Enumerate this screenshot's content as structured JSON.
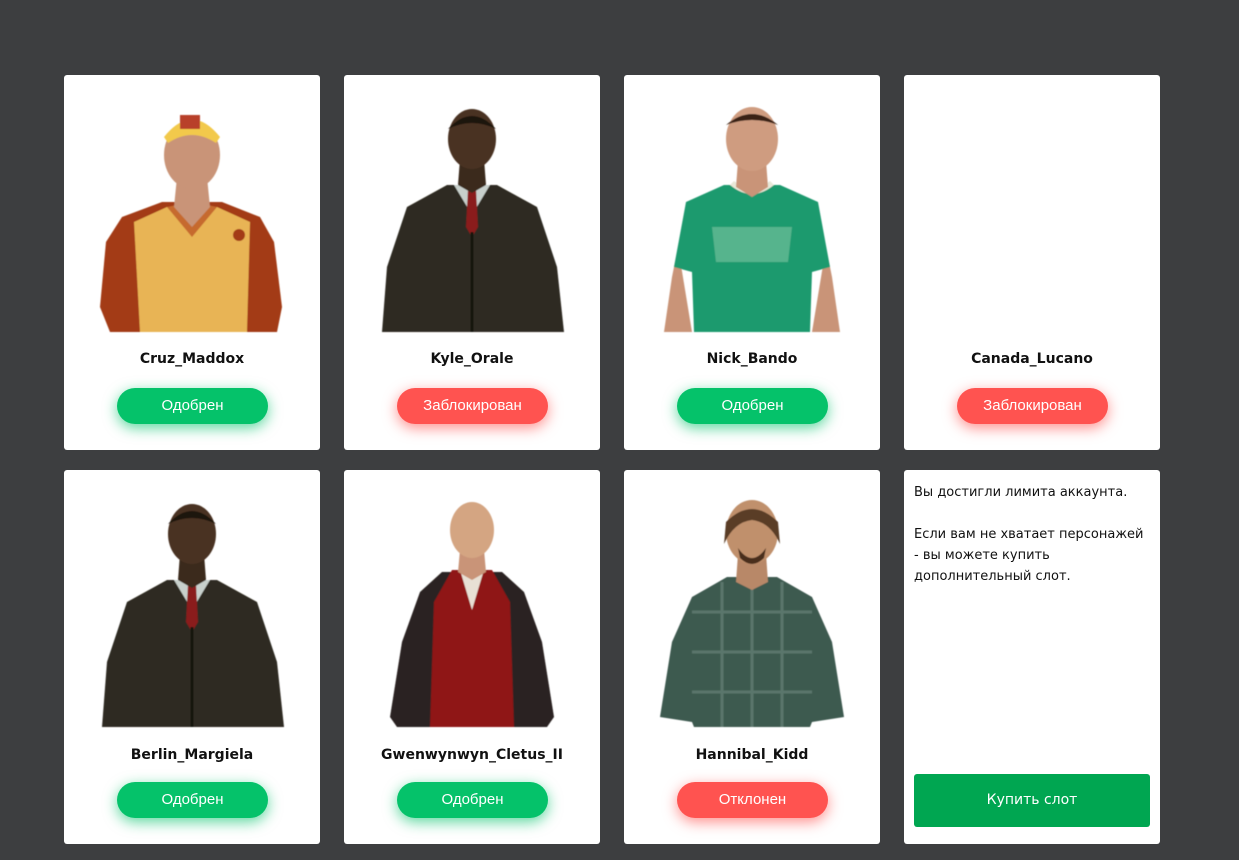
{
  "characters": [
    {
      "name": "Cruz_Maddox",
      "status": "Одобрен",
      "status_color": "#05c26a"
    },
    {
      "name": "Kyle_Orale",
      "status": "Заблокирован",
      "status_color": "#ff5350"
    },
    {
      "name": "Nick_Bando",
      "status": "Одобрен",
      "status_color": "#05c26a"
    },
    {
      "name": "Canada_Lucano",
      "status": "Заблокирован",
      "status_color": "#ff5350"
    },
    {
      "name": "Berlin_Margiela",
      "status": "Одобрен",
      "status_color": "#05c26a"
    },
    {
      "name": "Gwenwynwyn_Cletus_II",
      "status": "Одобрен",
      "status_color": "#05c26a"
    },
    {
      "name": "Hannibal_Kidd",
      "status": "Отклонен",
      "status_color": "#ff5350"
    }
  ],
  "limit_panel": {
    "message_1": "Вы достигли лимита аккаунта.",
    "message_2": "Если вам не хватает персонажей - вы можете купить дополнительный слот.",
    "buy_label": "Купить слот"
  },
  "colors": {
    "background": "#3d3e40",
    "approved": "#05c26a",
    "blocked": "#ff5350",
    "buy_button": "#00a651"
  }
}
